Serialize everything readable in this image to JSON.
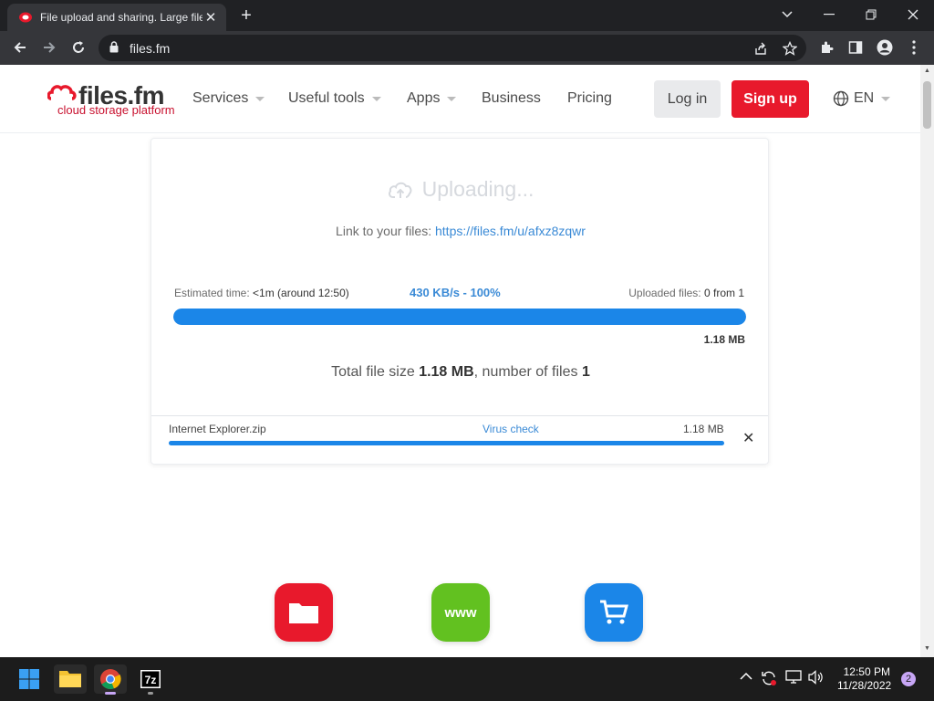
{
  "browser": {
    "tab_title": "File upload and sharing. Large file",
    "url": "files.fm"
  },
  "site": {
    "logo_name": "files.fm",
    "logo_tagline": "cloud storage platform",
    "nav": [
      "Services",
      "Useful tools",
      "Apps",
      "Business",
      "Pricing"
    ],
    "login_label": "Log in",
    "signup_label": "Sign up",
    "lang_label": "EN",
    "colors": {
      "accent": "#1b86e8",
      "brand_red": "#e8192c"
    }
  },
  "upload": {
    "status": "Uploading...",
    "link_prefix": "Link to your files:",
    "link_url": "https://files.fm/u/afxz8zqwr",
    "est_label": "Estimated time:",
    "est_value": "<1m (around 12:50)",
    "speed": "430 KB/s - 100%",
    "uploaded_label": "Uploaded files:",
    "uploaded_value": "0 from 1",
    "progress": 1.0,
    "size_right": "1.18 MB",
    "total_prefix": "Total file size",
    "total_size": "1.18 MB",
    "total_mid": ", number of files",
    "total_count": "1",
    "file": {
      "name": "Internet Explorer.zip",
      "status": "Virus check",
      "size": "1.18 MB",
      "progress": 1.0
    }
  },
  "apps_icons": [
    "folder-icon",
    "www-icon",
    "cart-icon"
  ],
  "taskbar": {
    "time": "12:50 PM",
    "date": "11/28/2022",
    "notifications": "2"
  }
}
